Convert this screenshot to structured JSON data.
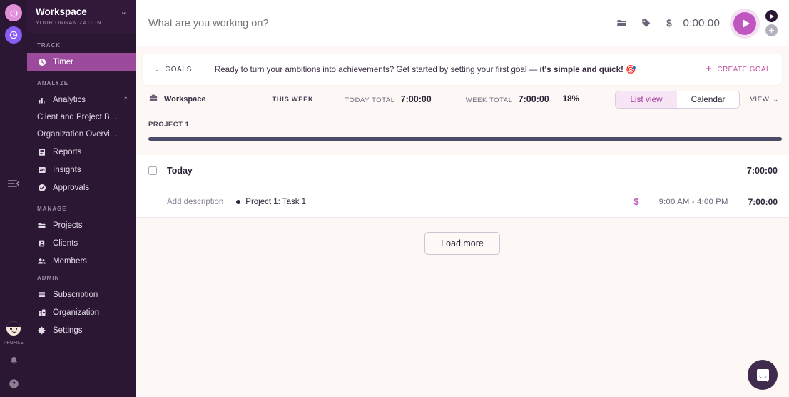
{
  "rail": {
    "power_icon": "power-icon",
    "clock_icon": "clock-icon",
    "collapse_icon": "collapse-sidebar-icon",
    "profile_label": "PROFILE",
    "bell_icon": "bell-icon",
    "help_icon": "help-icon"
  },
  "sidebar": {
    "workspace_title": "Workspace",
    "workspace_subtitle": "YOUR ORGANIZATION",
    "chevron": "⌄",
    "sections": [
      {
        "label": "TRACK",
        "items": [
          {
            "label": "Timer",
            "icon": "clock-icon",
            "active": true
          }
        ]
      },
      {
        "label": "ANALYZE",
        "items": [
          {
            "label": "Analytics",
            "icon": "bar-chart-icon",
            "expanded": true,
            "chevron": "⌃"
          },
          {
            "label": "Client and Project B...",
            "icon": "",
            "sub": true
          },
          {
            "label": "Organization Overvi...",
            "icon": "",
            "sub": true
          },
          {
            "label": "Reports",
            "icon": "report-icon"
          },
          {
            "label": "Insights",
            "icon": "insights-icon"
          },
          {
            "label": "Approvals",
            "icon": "check-circle-icon"
          }
        ]
      },
      {
        "label": "MANAGE",
        "items": [
          {
            "label": "Projects",
            "icon": "folder-icon"
          },
          {
            "label": "Clients",
            "icon": "contact-card-icon"
          },
          {
            "label": "Members",
            "icon": "people-icon"
          }
        ]
      },
      {
        "label": "ADMIN",
        "items": [
          {
            "label": "Subscription",
            "icon": "card-icon"
          },
          {
            "label": "Organization",
            "icon": "building-icon"
          },
          {
            "label": "Settings",
            "icon": "gear-icon"
          }
        ]
      }
    ]
  },
  "topbar": {
    "input_placeholder": "What are you working on?",
    "input_value": "",
    "project_icon": "folder-icon",
    "tag_icon": "tag-icon",
    "billable_icon": "dollar-icon",
    "timer_value": "0:00:00",
    "play_label": "start-timer",
    "mode_timer_icon": "play-icon",
    "mode_manual_icon": "plus-circle-icon"
  },
  "goals": {
    "chevron": "⌄",
    "label": "GOALS",
    "message_plain": "Ready to turn your ambitions into achievements? Get started by setting your first goal — ",
    "message_bold": "it's simple and quick!",
    "emoji": "🎯",
    "create_label": "CREATE GOAL",
    "create_plus": "+"
  },
  "stats": {
    "workspace_label": "Workspace",
    "workspace_icon": "briefcase-icon",
    "period": "THIS WEEK",
    "today_key": "TODAY TOTAL",
    "today_value": "7:00:00",
    "week_key": "WEEK TOTAL",
    "week_value": "7:00:00",
    "percent": "18%",
    "view_list": "List view",
    "view_calendar": "Calendar",
    "view_menu": "VIEW",
    "view_menu_chevron": "⌄"
  },
  "project_summary": {
    "name": "PROJECT 1",
    "bar_color": "#4c4c68",
    "bar_percent": 100
  },
  "entries": {
    "day": {
      "label": "Today",
      "total": "7:00:00"
    },
    "rows": [
      {
        "description_placeholder": "Add description",
        "project": "Project 1: Task 1",
        "billable_icon": "dollar-icon",
        "time_range": "9:00 AM - 4:00 PM",
        "duration": "7:00:00"
      }
    ],
    "load_more": "Load more"
  },
  "chat": {
    "icon": "chat-bubble-icon"
  },
  "colors": {
    "sidebar_bg": "#2b1634",
    "sidebar_active": "#9c4a9c",
    "accent_pink": "#c057c0",
    "accent_magenta": "#c4489c",
    "page_bg": "#fdf8f5",
    "text_dark": "#2e2439"
  }
}
